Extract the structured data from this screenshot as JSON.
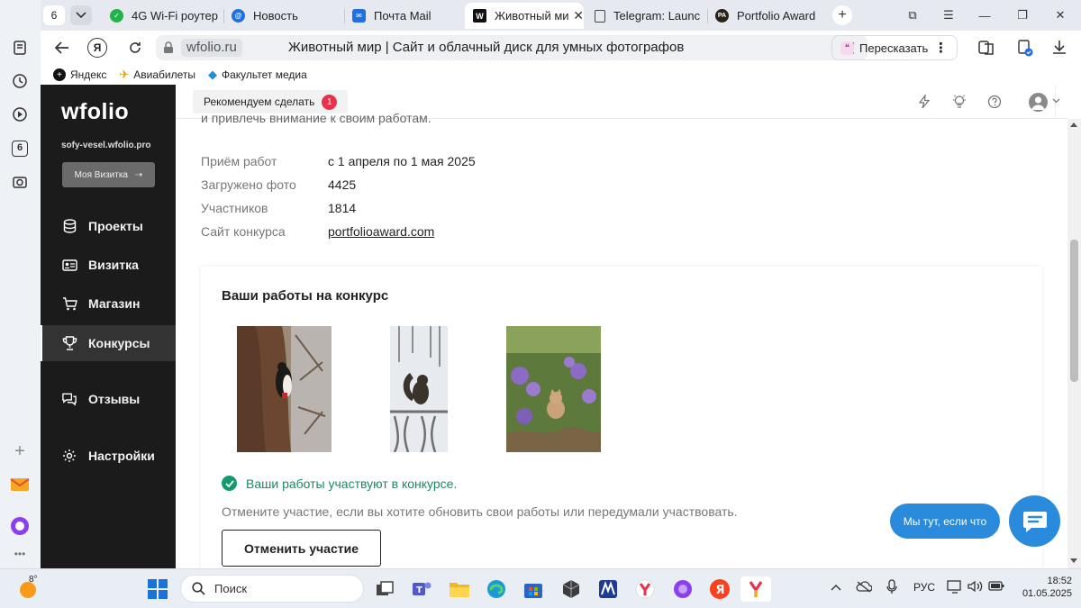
{
  "browser": {
    "tab_count_badge": "6",
    "tabs": [
      {
        "label": "4G Wi-Fi роутер",
        "icon": "ok-circle-icon",
        "color": "#25b14a"
      },
      {
        "label": "Новость",
        "icon": "at-icon",
        "color": "#1f6fe5"
      },
      {
        "label": "Почта Mail",
        "icon": "mail-icon",
        "color": "#1f6fe5"
      },
      {
        "label": "Животный ми",
        "icon": "wfolio-w-icon",
        "color": "#111111",
        "active": true
      },
      {
        "label": "Telegram: Launc",
        "icon": "document-icon",
        "color": "#444444"
      },
      {
        "label": "Portfolio Award",
        "icon": "pa-logo-icon",
        "color": "#2b2018",
        "fav_text": "PA"
      }
    ],
    "url_host": "wfolio.ru",
    "page_title": "Животный мир | Сайт и облачный диск для умных фотографов",
    "retell_label": "Пересказать",
    "bookmarks": [
      {
        "label": "Яндекс",
        "icon": "yandex-icon"
      },
      {
        "label": "Авиабилеты",
        "icon": "plane-icon"
      },
      {
        "label": "Факультет медиа",
        "icon": "drop-icon"
      }
    ],
    "rail_badge": "6"
  },
  "sidebar": {
    "logo": "wfolio",
    "site": "sofy-vesel.wfolio.pro",
    "card_button": "Моя Визитка",
    "nav": [
      {
        "label": "Проекты",
        "icon": "database-icon"
      },
      {
        "label": "Визитка",
        "icon": "id-card-icon"
      },
      {
        "label": "Магазин",
        "icon": "cart-icon"
      },
      {
        "label": "Конкурсы",
        "icon": "trophy-icon",
        "active": true
      },
      {
        "label": "Отзывы",
        "icon": "chat-icon"
      },
      {
        "label": "Настройки",
        "icon": "gear-icon"
      }
    ]
  },
  "topbar": {
    "recommend_label": "Рекомендуем сделать",
    "recommend_count": "1"
  },
  "contest": {
    "cut_text": "и привлечь внимание к своим работам.",
    "info": [
      {
        "key": "Приём работ",
        "value": "с 1 апреля по 1 мая 2025"
      },
      {
        "key": "Загружено фото",
        "value": "4425"
      },
      {
        "key": "Участников",
        "value": "1814"
      },
      {
        "key": "Сайт конкурса",
        "value": "portfolioaward.com",
        "link": true
      }
    ],
    "card_title": "Ваши работы на конкурс",
    "photos": [
      {
        "subject": "woodpecker-photo"
      },
      {
        "subject": "squirrel-photo"
      },
      {
        "subject": "kitten-photo"
      }
    ],
    "status": "Ваши работы участвуют в конкурсе.",
    "hint": "Отмените участие, если вы хотите обновить свои работы или передумали участвовать.",
    "cancel_label": "Отменить участие"
  },
  "chat": {
    "pill": "Мы тут, если что"
  },
  "taskbar": {
    "weather": "8°",
    "search_placeholder": "Поиск",
    "lang": "РУС",
    "time": "18:52",
    "date": "01.05.2025"
  },
  "colors": {
    "accent_blue": "#2a8adb",
    "success_green": "#1a8a63",
    "sidebar_bg": "#1b1b1b",
    "badge_red": "#e8324b"
  }
}
